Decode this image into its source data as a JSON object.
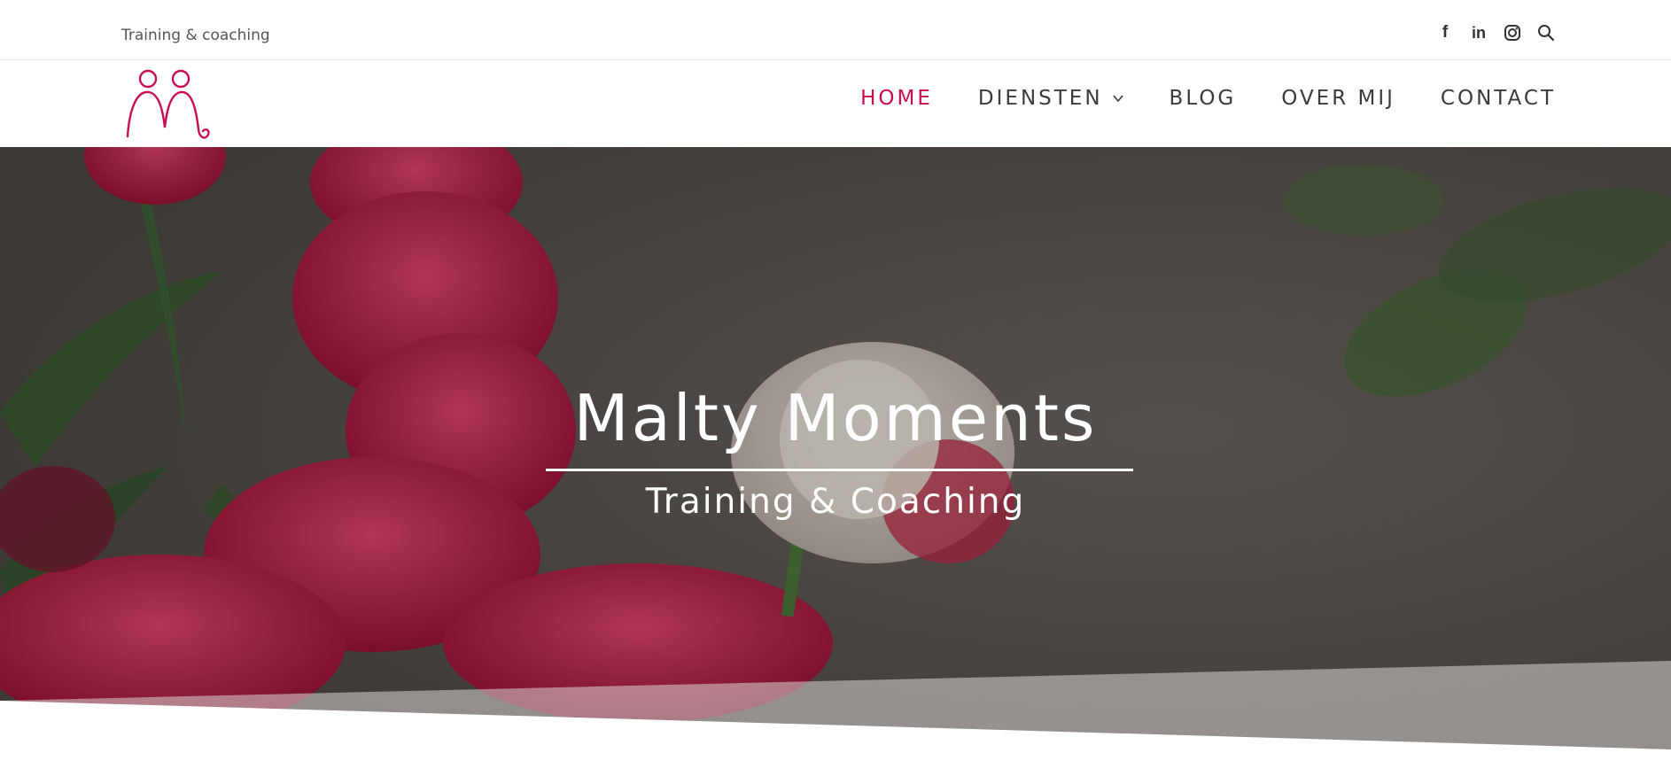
{
  "topbar": {
    "tagline": "Training & coaching",
    "social": [
      {
        "name": "facebook-icon",
        "glyph": "f"
      },
      {
        "name": "linkedin-icon",
        "glyph": "in"
      },
      {
        "name": "instagram-icon",
        "glyph": ""
      },
      {
        "name": "search-icon",
        "glyph": ""
      }
    ]
  },
  "nav": {
    "items": [
      {
        "label": "HOME",
        "active": true
      },
      {
        "label": "DIENSTEN",
        "has_dropdown": true
      },
      {
        "label": "BLOG"
      },
      {
        "label": "OVER MIJ"
      },
      {
        "label": "CONTACT"
      }
    ]
  },
  "hero": {
    "title": "Malty Moments",
    "subtitle": "Training & Coaching"
  },
  "colors": {
    "accent": "#c90d52",
    "nav_text": "#3b3b3b"
  }
}
